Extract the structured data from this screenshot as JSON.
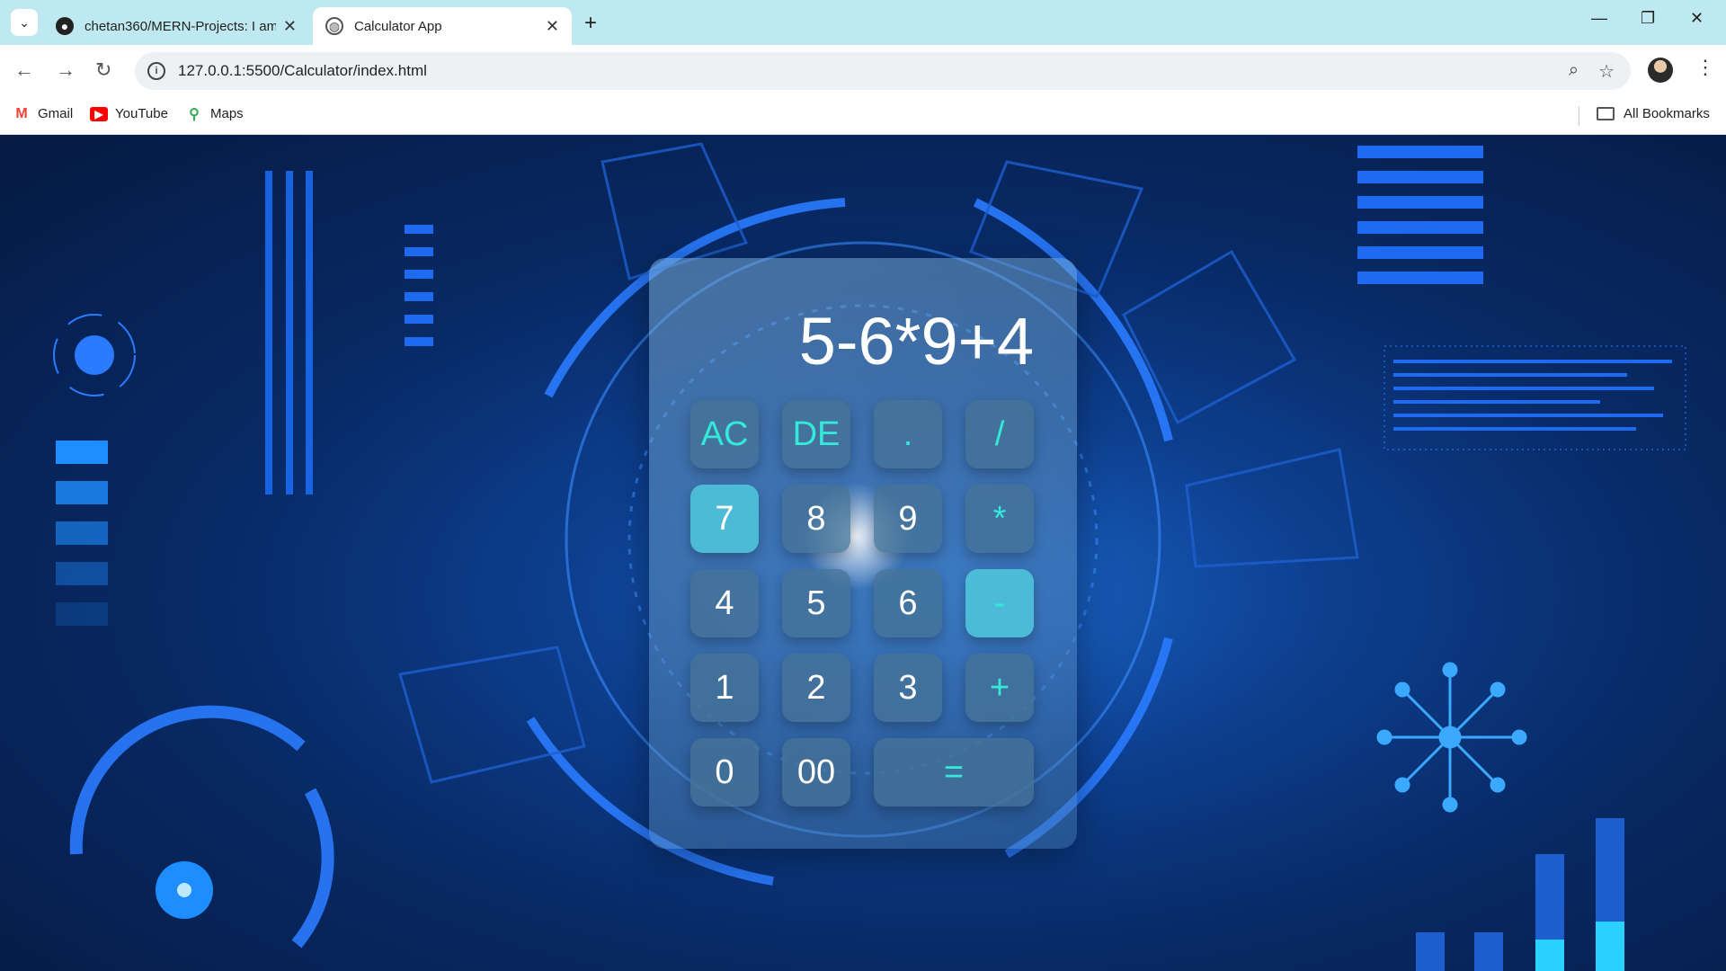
{
  "browser": {
    "tabs": [
      {
        "title": "chetan360/MERN-Projects: I am",
        "favicon": "github-icon",
        "active": false
      },
      {
        "title": "Calculator App",
        "favicon": "globe-icon",
        "active": true
      }
    ],
    "url": "127.0.0.1:5500/Calculator/index.html",
    "bookmarks": [
      {
        "label": "Gmail",
        "icon": "gmail-icon"
      },
      {
        "label": "YouTube",
        "icon": "youtube-icon"
      },
      {
        "label": "Maps",
        "icon": "maps-icon"
      }
    ],
    "all_bookmarks_label": "All Bookmarks"
  },
  "calculator": {
    "display": "5-6*9+4",
    "keys": [
      {
        "label": "AC",
        "type": "operator"
      },
      {
        "label": "DE",
        "type": "operator"
      },
      {
        "label": ".",
        "type": "operator"
      },
      {
        "label": "/",
        "type": "operator"
      },
      {
        "label": "7",
        "type": "digit"
      },
      {
        "label": "8",
        "type": "digit"
      },
      {
        "label": "9",
        "type": "digit"
      },
      {
        "label": "*",
        "type": "operator"
      },
      {
        "label": "4",
        "type": "digit"
      },
      {
        "label": "5",
        "type": "digit"
      },
      {
        "label": "6",
        "type": "digit"
      },
      {
        "label": "-",
        "type": "operator"
      },
      {
        "label": "1",
        "type": "digit"
      },
      {
        "label": "2",
        "type": "digit"
      },
      {
        "label": "3",
        "type": "digit"
      },
      {
        "label": "+",
        "type": "operator"
      },
      {
        "label": "0",
        "type": "digit"
      },
      {
        "label": "00",
        "type": "digit"
      },
      {
        "label": "=",
        "type": "operator"
      }
    ],
    "accent_color": "#34e8da"
  }
}
